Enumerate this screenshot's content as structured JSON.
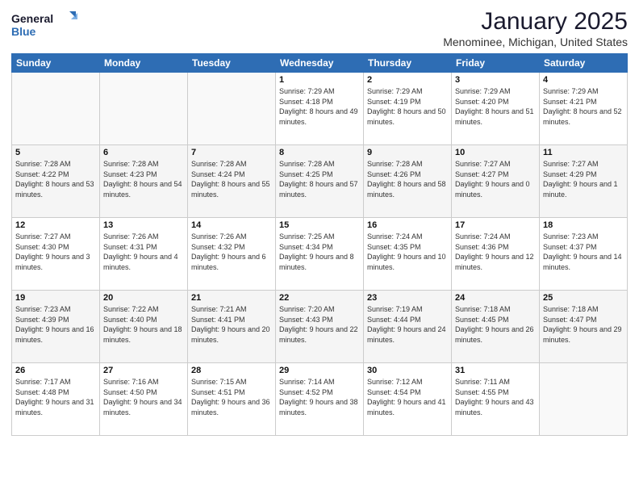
{
  "header": {
    "logo_line1": "General",
    "logo_line2": "Blue",
    "month_title": "January 2025",
    "location": "Menominee, Michigan, United States"
  },
  "days_of_week": [
    "Sunday",
    "Monday",
    "Tuesday",
    "Wednesday",
    "Thursday",
    "Friday",
    "Saturday"
  ],
  "weeks": [
    [
      {
        "day": "",
        "detail": ""
      },
      {
        "day": "",
        "detail": ""
      },
      {
        "day": "",
        "detail": ""
      },
      {
        "day": "1",
        "detail": "Sunrise: 7:29 AM\nSunset: 4:18 PM\nDaylight: 8 hours\nand 49 minutes."
      },
      {
        "day": "2",
        "detail": "Sunrise: 7:29 AM\nSunset: 4:19 PM\nDaylight: 8 hours\nand 50 minutes."
      },
      {
        "day": "3",
        "detail": "Sunrise: 7:29 AM\nSunset: 4:20 PM\nDaylight: 8 hours\nand 51 minutes."
      },
      {
        "day": "4",
        "detail": "Sunrise: 7:29 AM\nSunset: 4:21 PM\nDaylight: 8 hours\nand 52 minutes."
      }
    ],
    [
      {
        "day": "5",
        "detail": "Sunrise: 7:28 AM\nSunset: 4:22 PM\nDaylight: 8 hours\nand 53 minutes."
      },
      {
        "day": "6",
        "detail": "Sunrise: 7:28 AM\nSunset: 4:23 PM\nDaylight: 8 hours\nand 54 minutes."
      },
      {
        "day": "7",
        "detail": "Sunrise: 7:28 AM\nSunset: 4:24 PM\nDaylight: 8 hours\nand 55 minutes."
      },
      {
        "day": "8",
        "detail": "Sunrise: 7:28 AM\nSunset: 4:25 PM\nDaylight: 8 hours\nand 57 minutes."
      },
      {
        "day": "9",
        "detail": "Sunrise: 7:28 AM\nSunset: 4:26 PM\nDaylight: 8 hours\nand 58 minutes."
      },
      {
        "day": "10",
        "detail": "Sunrise: 7:27 AM\nSunset: 4:27 PM\nDaylight: 9 hours\nand 0 minutes."
      },
      {
        "day": "11",
        "detail": "Sunrise: 7:27 AM\nSunset: 4:29 PM\nDaylight: 9 hours\nand 1 minute."
      }
    ],
    [
      {
        "day": "12",
        "detail": "Sunrise: 7:27 AM\nSunset: 4:30 PM\nDaylight: 9 hours\nand 3 minutes."
      },
      {
        "day": "13",
        "detail": "Sunrise: 7:26 AM\nSunset: 4:31 PM\nDaylight: 9 hours\nand 4 minutes."
      },
      {
        "day": "14",
        "detail": "Sunrise: 7:26 AM\nSunset: 4:32 PM\nDaylight: 9 hours\nand 6 minutes."
      },
      {
        "day": "15",
        "detail": "Sunrise: 7:25 AM\nSunset: 4:34 PM\nDaylight: 9 hours\nand 8 minutes."
      },
      {
        "day": "16",
        "detail": "Sunrise: 7:24 AM\nSunset: 4:35 PM\nDaylight: 9 hours\nand 10 minutes."
      },
      {
        "day": "17",
        "detail": "Sunrise: 7:24 AM\nSunset: 4:36 PM\nDaylight: 9 hours\nand 12 minutes."
      },
      {
        "day": "18",
        "detail": "Sunrise: 7:23 AM\nSunset: 4:37 PM\nDaylight: 9 hours\nand 14 minutes."
      }
    ],
    [
      {
        "day": "19",
        "detail": "Sunrise: 7:23 AM\nSunset: 4:39 PM\nDaylight: 9 hours\nand 16 minutes."
      },
      {
        "day": "20",
        "detail": "Sunrise: 7:22 AM\nSunset: 4:40 PM\nDaylight: 9 hours\nand 18 minutes."
      },
      {
        "day": "21",
        "detail": "Sunrise: 7:21 AM\nSunset: 4:41 PM\nDaylight: 9 hours\nand 20 minutes."
      },
      {
        "day": "22",
        "detail": "Sunrise: 7:20 AM\nSunset: 4:43 PM\nDaylight: 9 hours\nand 22 minutes."
      },
      {
        "day": "23",
        "detail": "Sunrise: 7:19 AM\nSunset: 4:44 PM\nDaylight: 9 hours\nand 24 minutes."
      },
      {
        "day": "24",
        "detail": "Sunrise: 7:18 AM\nSunset: 4:45 PM\nDaylight: 9 hours\nand 26 minutes."
      },
      {
        "day": "25",
        "detail": "Sunrise: 7:18 AM\nSunset: 4:47 PM\nDaylight: 9 hours\nand 29 minutes."
      }
    ],
    [
      {
        "day": "26",
        "detail": "Sunrise: 7:17 AM\nSunset: 4:48 PM\nDaylight: 9 hours\nand 31 minutes."
      },
      {
        "day": "27",
        "detail": "Sunrise: 7:16 AM\nSunset: 4:50 PM\nDaylight: 9 hours\nand 34 minutes."
      },
      {
        "day": "28",
        "detail": "Sunrise: 7:15 AM\nSunset: 4:51 PM\nDaylight: 9 hours\nand 36 minutes."
      },
      {
        "day": "29",
        "detail": "Sunrise: 7:14 AM\nSunset: 4:52 PM\nDaylight: 9 hours\nand 38 minutes."
      },
      {
        "day": "30",
        "detail": "Sunrise: 7:12 AM\nSunset: 4:54 PM\nDaylight: 9 hours\nand 41 minutes."
      },
      {
        "day": "31",
        "detail": "Sunrise: 7:11 AM\nSunset: 4:55 PM\nDaylight: 9 hours\nand 43 minutes."
      },
      {
        "day": "",
        "detail": ""
      }
    ]
  ]
}
